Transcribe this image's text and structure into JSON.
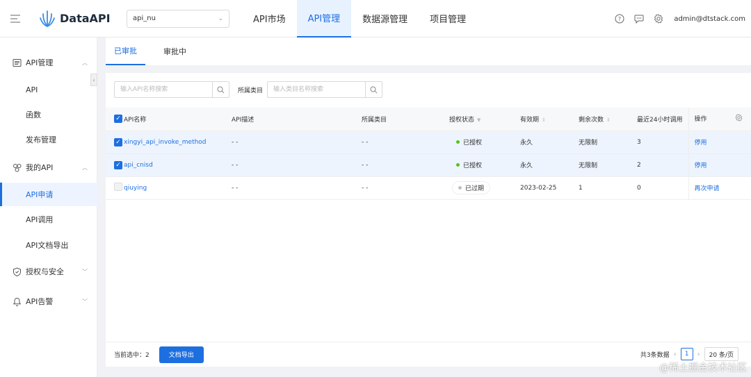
{
  "app": {
    "name": "DataAPI"
  },
  "header": {
    "project": "api_nu",
    "nav": [
      "API市场",
      "API管理",
      "数据源管理",
      "项目管理"
    ],
    "active_nav": 1,
    "user": "admin@dtstack.com"
  },
  "sidebar": {
    "groups": [
      {
        "label": "API管理",
        "icon": "api-list-icon",
        "items": [
          "API",
          "函数",
          "发布管理"
        ]
      },
      {
        "label": "我的API",
        "icon": "my-api-icon",
        "items": [
          "API申请",
          "API调用",
          "API文档导出"
        ]
      },
      {
        "label": "授权与安全",
        "icon": "shield-icon",
        "items": []
      },
      {
        "label": "API告警",
        "icon": "bell-icon",
        "items": []
      }
    ],
    "active_item": "API申请"
  },
  "tabs": [
    "已审批",
    "审批中"
  ],
  "filters": {
    "api_search_placeholder": "输入API名称搜索",
    "category_label": "所属类目",
    "category_search_placeholder": "输入类目名称搜索"
  },
  "table": {
    "columns": [
      "API名称",
      "API描述",
      "所属类目",
      "授权状态",
      "有效期",
      "剩余次数",
      "最近24小时调用",
      "操作"
    ],
    "rows": [
      {
        "checked": true,
        "name": "xingyi_api_invoke_method",
        "desc": "- -",
        "category": "- -",
        "status": "已授权",
        "status_color": "#52c41a",
        "validity": "永久",
        "remaining": "无限制",
        "calls24h": "3",
        "action": "停用"
      },
      {
        "checked": true,
        "name": "api_cnisd",
        "desc": "- -",
        "category": "- -",
        "status": "已授权",
        "status_color": "#52c41a",
        "validity": "永久",
        "remaining": "无限制",
        "calls24h": "2",
        "action": "停用"
      },
      {
        "checked": false,
        "name": "qiuying",
        "desc": "- -",
        "category": "- -",
        "status": "已过期",
        "status_color": "#bfbfbf",
        "validity": "2023-02-25",
        "remaining": "1",
        "calls24h": "0",
        "action": "再次申请"
      }
    ]
  },
  "footer": {
    "selected_label": "当前选中：",
    "selected_count": "2",
    "export_label": "文档导出",
    "total": "共3条数据",
    "page": "1",
    "page_size": "20 条/页"
  },
  "watermark": "@稀土掘金技术社区",
  "colors": {
    "accent": "#1d6fe0",
    "selected_row": "#eef4fd"
  }
}
